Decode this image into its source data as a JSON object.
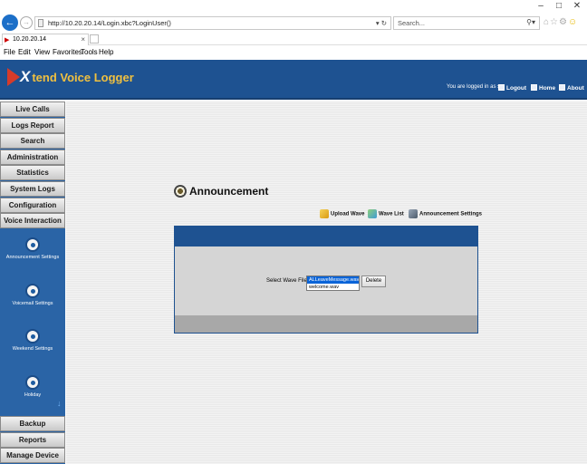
{
  "browser": {
    "url": "http://10.20.20.14/Login.xbc?LoginUser()",
    "search_placeholder": "Search...",
    "tab_title": "10.20.20.14",
    "menu": [
      "File",
      "Edit",
      "View",
      "Favorites",
      "Tools",
      "Help"
    ],
    "window_controls": [
      "–",
      "□",
      "✕"
    ]
  },
  "header": {
    "logo_x": "X",
    "logo_rest": "tend Voice Logger",
    "logged_in": "You are logged in as s",
    "links": [
      "Logout",
      "Home",
      "About"
    ]
  },
  "sidebar": {
    "top_items": [
      "Live Calls",
      "Logs Report",
      "Search",
      "Administration",
      "Statistics",
      "System Logs",
      "Configuration",
      "Voice Interaction"
    ],
    "tools": [
      "Announcement Settings",
      "Voicemail Settings",
      "Weekend Settings",
      "Holiday"
    ],
    "bottom_items": [
      "Backup",
      "Reports",
      "Manage Device"
    ]
  },
  "main": {
    "title": "Announcement",
    "actions": [
      "Upload Wave",
      "Wave List",
      "Announcement Settings"
    ],
    "select_label": "Select Wave File :",
    "wave_files": [
      "ALLeaveMessage.wav",
      "welcome.wav"
    ],
    "selected_index": 0,
    "delete_label": "Delete"
  },
  "colors": {
    "header_blue": "#1e5291",
    "sidebar_blue": "#2a64a6",
    "logo_red": "#d63b2a",
    "logo_gold": "#f0c040"
  }
}
